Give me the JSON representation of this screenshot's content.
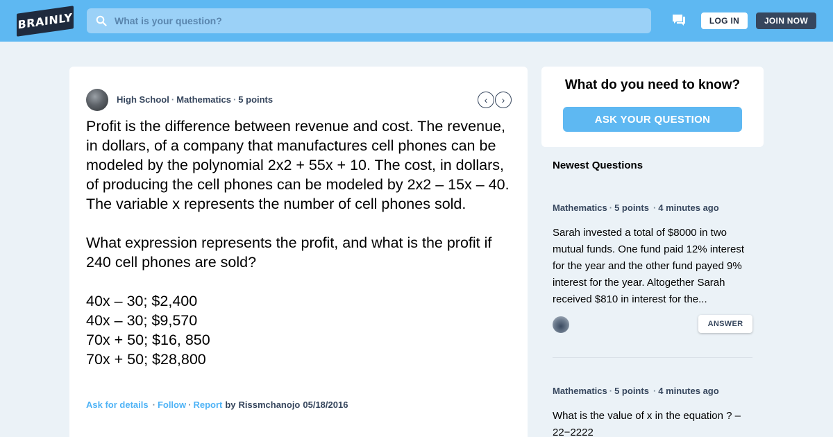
{
  "header": {
    "logo_text": "BRAINLY",
    "search_placeholder": "What is your question?",
    "login_label": "LOG IN",
    "join_label": "JOIN NOW"
  },
  "question": {
    "meta": {
      "school": "High School",
      "subject": "Mathematics",
      "points": "5 points"
    },
    "paragraphs": [
      "Profit is the difference between revenue and cost. The revenue, in dollars, of a company that manufactures cell phones can be modeled by the polynomial 2x2 + 55x + 10. The cost, in dollars, of producing the cell phones can be modeled by 2x2 – 15x – 40. The variable x represents the number of cell phones sold.",
      "What expression represents the profit, and what is the profit if 240 cell phones are sold?"
    ],
    "options": [
      "40x – 30; $2,400",
      "40x – 30; $9,570",
      "70x + 50; $16, 850",
      "70x + 50; $28,800"
    ],
    "footer": {
      "ask_details": "Ask for details",
      "follow": "Follow",
      "report": "Report",
      "by": "by",
      "author": "Rissmchanojo",
      "date": "05/18/2016"
    }
  },
  "sidebar": {
    "ask_title": "What do you need to know?",
    "ask_button": "ASK YOUR QUESTION",
    "newest_heading": "Newest Questions",
    "items": [
      {
        "subject": "Mathematics",
        "points": "5 points",
        "time": "4 minutes ago",
        "text": "Sarah invested a total of $8000 in two mutual funds. One fund paid 12% interest for the year and the other fund payed 9% interest for the year. Altogether Sarah received $810 in interest for the...",
        "answer_label": "ANSWER"
      },
      {
        "subject": "Mathematics",
        "points": "5 points",
        "time": "4 minutes ago",
        "text": "What is the value of x in the equation ? –22−2222"
      }
    ]
  },
  "colors": {
    "brand_blue": "#5eb8f2",
    "dark": "#1f2a3d",
    "link_blue": "#4fb3f6"
  },
  "icons": [
    "search-icon",
    "messages-icon",
    "chevron-left-icon",
    "chevron-right-icon"
  ]
}
